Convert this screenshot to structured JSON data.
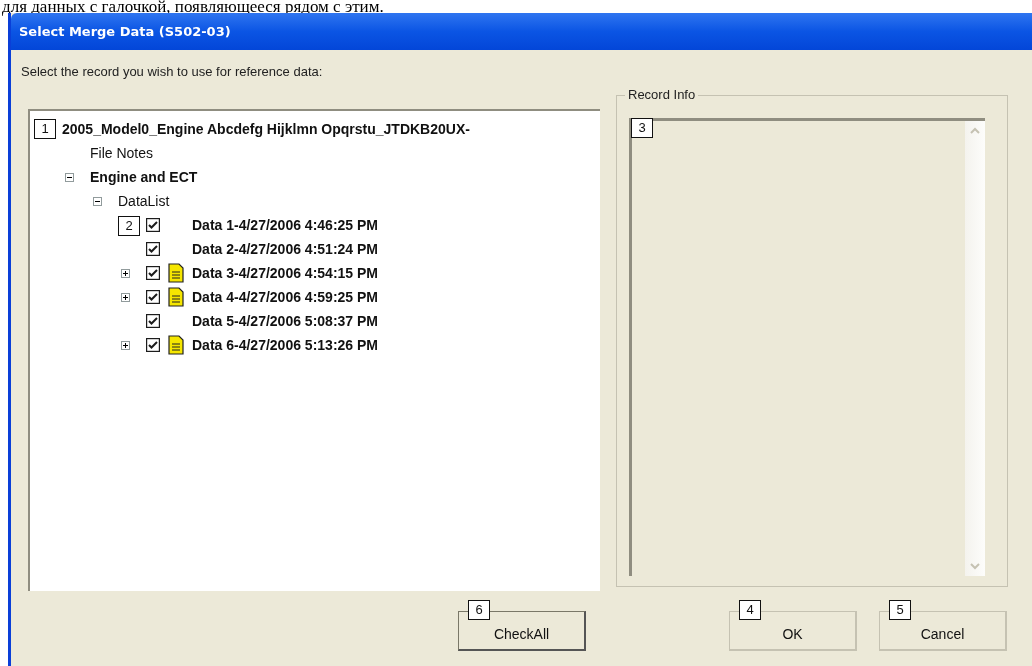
{
  "caption": "для данных с галочкой, появляющееся рядом с этим.",
  "window": {
    "title": "Select Merge Data (S502-03)"
  },
  "prompt": "Select the record you wish to use for reference data:",
  "tree": {
    "nodes": [
      {
        "label": "2005_Model0_Engine Abcdefg Hijklmn Opqrstu_JTDKB20UX-",
        "bold": true,
        "callout": "1",
        "children": [
          {
            "label": "File Notes",
            "bold": false
          },
          {
            "label": "Engine and ECT",
            "bold": true,
            "expanded": true,
            "children": [
              {
                "label": "DataList",
                "bold": false,
                "expanded": true,
                "children": [
                  {
                    "label": "Data 1-4/27/2006 4:46:25 PM",
                    "bold": true,
                    "checked": true,
                    "callout": "2"
                  },
                  {
                    "label": "Data 2-4/27/2006 4:51:24 PM",
                    "bold": true,
                    "checked": true
                  },
                  {
                    "label": "Data 3-4/27/2006 4:54:15 PM",
                    "bold": true,
                    "checked": true,
                    "expanded": false,
                    "note": true
                  },
                  {
                    "label": "Data 4-4/27/2006 4:59:25 PM",
                    "bold": true,
                    "checked": true,
                    "expanded": false,
                    "note": true
                  },
                  {
                    "label": "Data 5-4/27/2006 5:08:37 PM",
                    "bold": true,
                    "checked": true
                  },
                  {
                    "label": "Data 6-4/27/2006 5:13:26 PM",
                    "bold": true,
                    "checked": true,
                    "expanded": false,
                    "note": true
                  }
                ]
              }
            ]
          }
        ]
      }
    ]
  },
  "record_info": {
    "label": "Record Info",
    "callout": "3"
  },
  "buttons": [
    {
      "label": "CheckAll",
      "callout": "6"
    },
    {
      "label": "OK",
      "callout": "4"
    },
    {
      "label": "Cancel",
      "callout": "5"
    }
  ]
}
